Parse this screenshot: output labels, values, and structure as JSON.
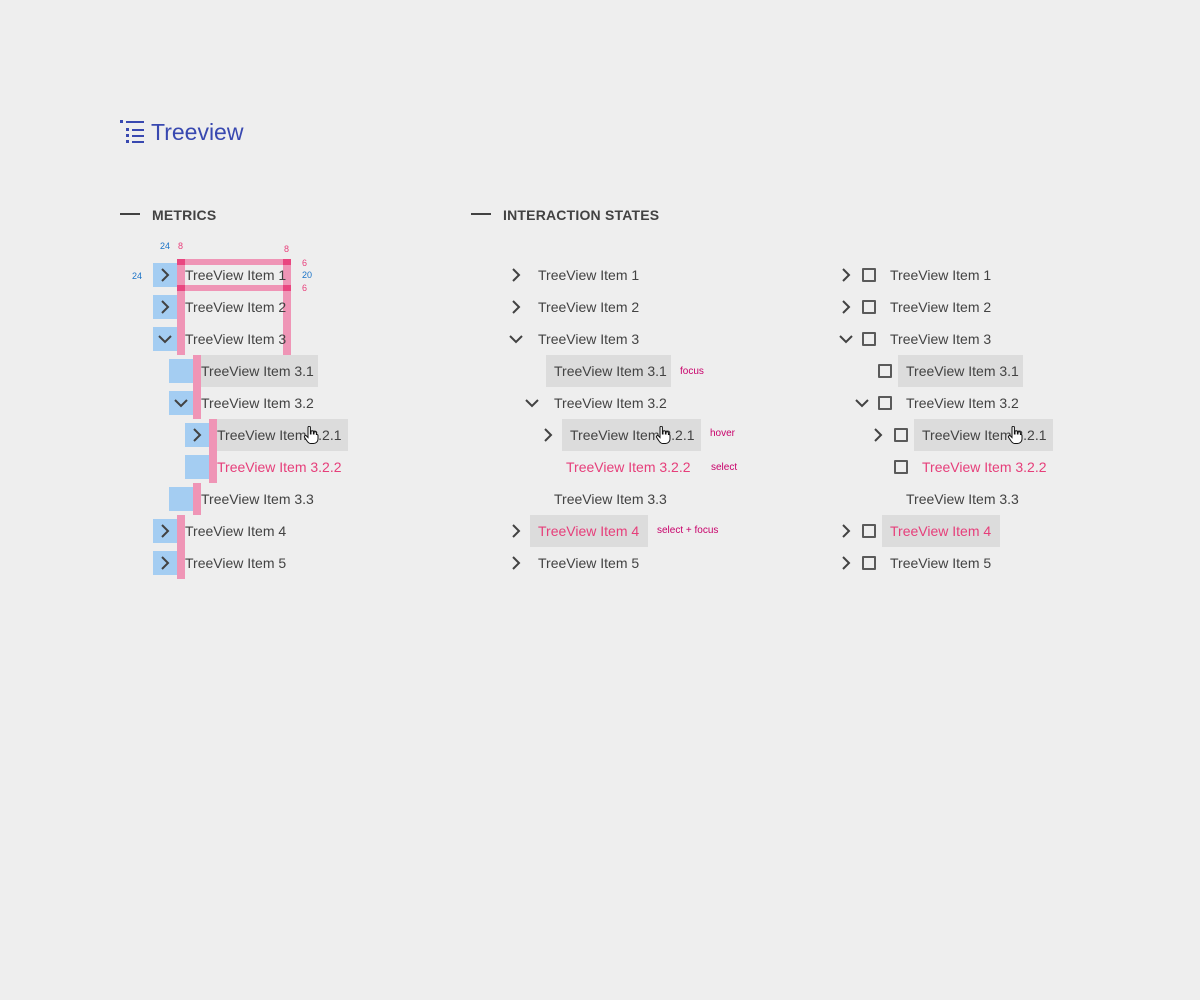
{
  "header": {
    "title": "Treeview",
    "icon": "treeview-icon"
  },
  "sections": {
    "metrics": "METRICS",
    "interaction_states": "INTERACTION STATES"
  },
  "metrics_annotations": {
    "toggle_width": "24",
    "left_indent": "8",
    "right_padding": "8",
    "top_padding": "6",
    "text_height": "20",
    "bottom_padding": "6",
    "row_height": "24"
  },
  "tree": {
    "item1": "TreeView Item 1",
    "item2": "TreeView Item 2",
    "item3": "TreeView Item 3",
    "item31": "TreeView Item 3.1",
    "item32": "TreeView Item 3.2",
    "item321": "TreeView Item 3.2.1",
    "item322": "TreeView Item 3.2.2",
    "item33": "TreeView Item 3.3",
    "item4": "TreeView Item 4",
    "item5": "TreeView Item 5"
  },
  "states": {
    "focus": "focus",
    "hover": "hover",
    "select": "select",
    "select_focus": "select + focus"
  },
  "colors": {
    "accent": "#3848b0",
    "selected_text": "#e63e7a",
    "highlight_bg": "#dcdcdc",
    "metric_blue": "#a4cdf2",
    "metric_pink": "#ef85ab",
    "state_label": "#c8006a"
  }
}
